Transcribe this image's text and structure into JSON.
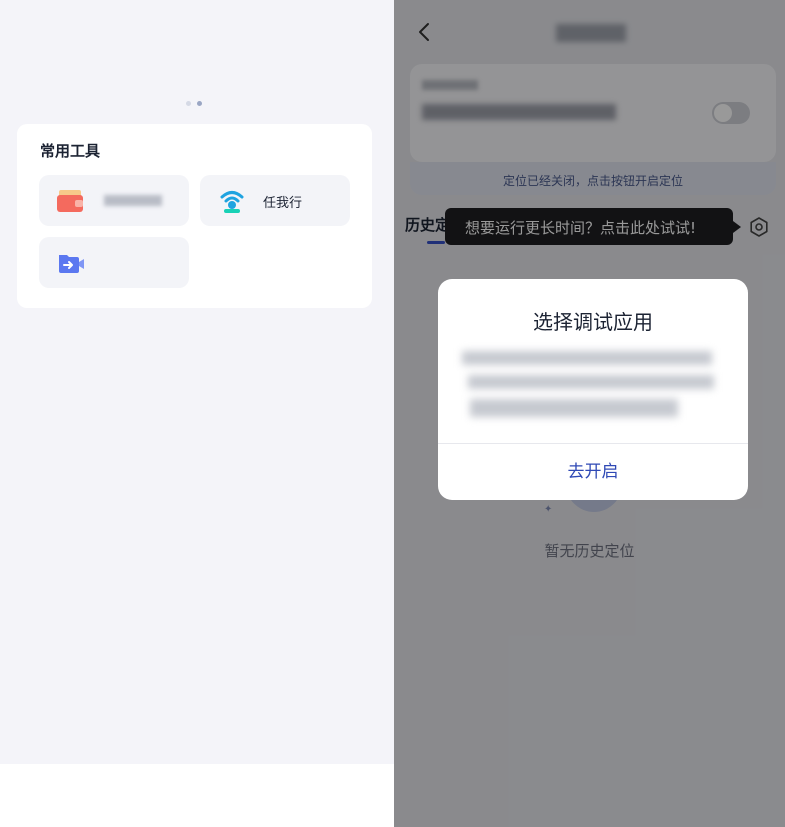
{
  "left": {
    "common_tools": {
      "title": "常用工具",
      "items": [
        {
          "icon": "wallet-icon",
          "label": ""
        },
        {
          "icon": "wifi-location-icon",
          "label": "任我行"
        },
        {
          "icon": "video-transfer-icon",
          "label": ""
        }
      ]
    }
  },
  "right": {
    "location_status": "定位已经关闭，点击按钮开启定位",
    "tab_history": "历史定位",
    "tooltip": "想要运行更长时间？点击此处试试!",
    "empty_text": "暂无历史定位"
  },
  "dialog": {
    "title": "选择调试应用",
    "button": "去开启"
  },
  "colors": {
    "accent": "#2f49b5",
    "left_background": "#f4f4f9",
    "overlay": "rgba(0,0,0,0.4)",
    "tooltip_bg": "#1e1f22"
  }
}
